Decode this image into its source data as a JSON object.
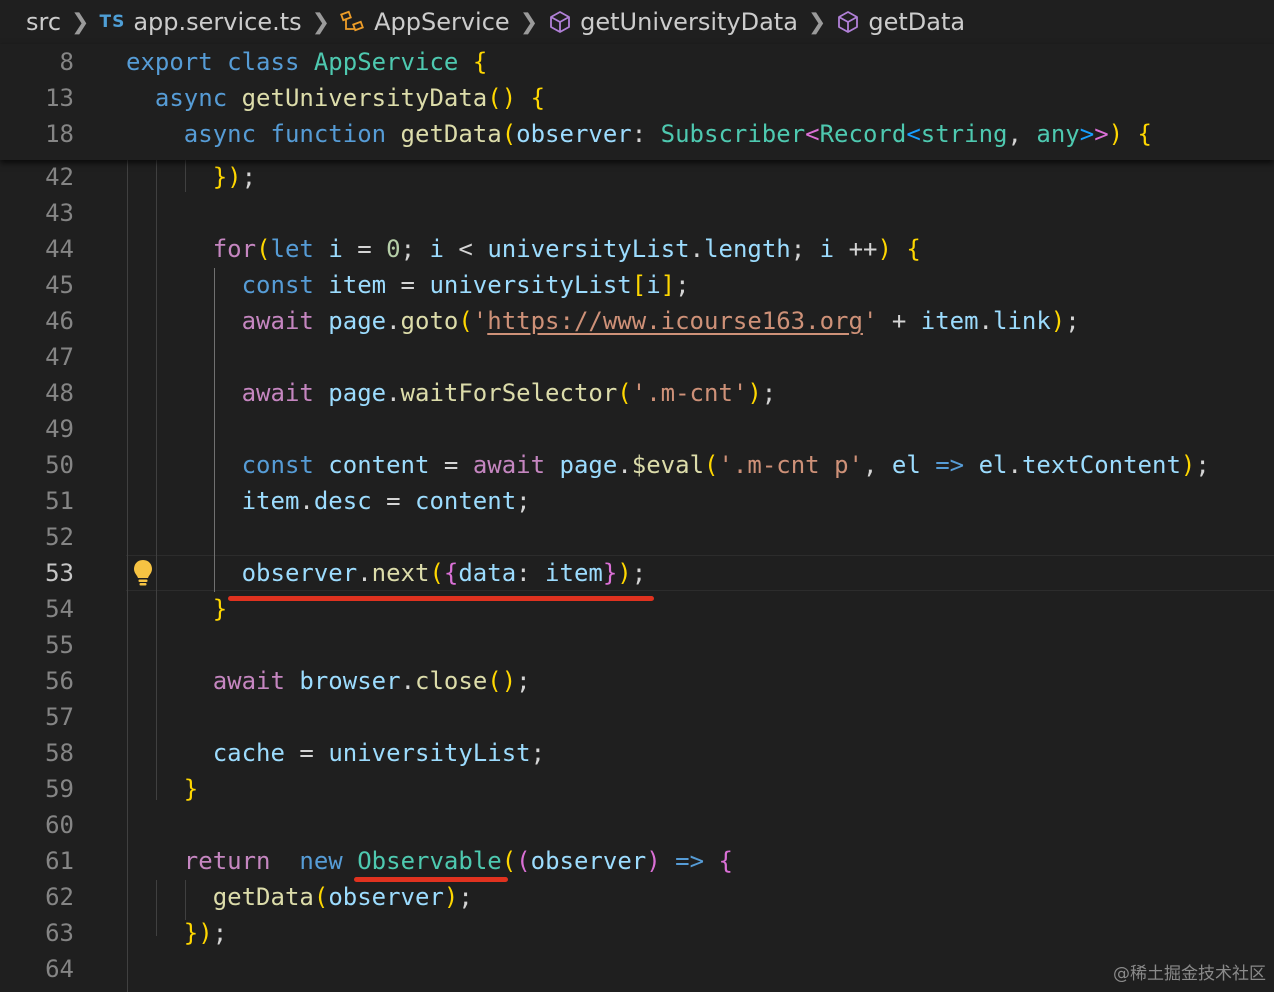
{
  "breadcrumb": {
    "folder": "src",
    "file_icon": "TS",
    "file": "app.service.ts",
    "class": "AppService",
    "method": "getUniversityData",
    "function": "getData"
  },
  "icons": {
    "typescript_file": "ts-file-icon",
    "class": "class-icon",
    "method": "method-cube-icon",
    "lightbulb": "lightbulb-icon"
  },
  "sticky_lines": [
    {
      "num": "8",
      "text": "export class AppService {"
    },
    {
      "num": "13",
      "text": "  async getUniversityData() {"
    },
    {
      "num": "18",
      "text": "    async function getData(observer: Subscriber<Record<string, any>>) {"
    }
  ],
  "lines": [
    {
      "num": "42",
      "text": "      });"
    },
    {
      "num": "43",
      "text": ""
    },
    {
      "num": "44",
      "text": "      for(let i = 0; i < universityList.length; i ++) {"
    },
    {
      "num": "45",
      "text": "        const item = universityList[i];"
    },
    {
      "num": "46",
      "text": "        await page.goto('https://www.icourse163.org' + item.link);"
    },
    {
      "num": "47",
      "text": ""
    },
    {
      "num": "48",
      "text": "        await page.waitForSelector('.m-cnt');"
    },
    {
      "num": "49",
      "text": ""
    },
    {
      "num": "50",
      "text": "        const content = await page.$eval('.m-cnt p', el => el.textContent);"
    },
    {
      "num": "51",
      "text": "        item.desc = content;"
    },
    {
      "num": "52",
      "text": ""
    },
    {
      "num": "53",
      "text": "        observer.next({data: item});"
    },
    {
      "num": "54",
      "text": "      }"
    },
    {
      "num": "55",
      "text": ""
    },
    {
      "num": "56",
      "text": "      await browser.close();"
    },
    {
      "num": "57",
      "text": ""
    },
    {
      "num": "58",
      "text": "      cache = universityList;"
    },
    {
      "num": "59",
      "text": "    }"
    },
    {
      "num": "60",
      "text": ""
    },
    {
      "num": "61",
      "text": "    return  new Observable((observer) => {"
    },
    {
      "num": "62",
      "text": "      getData(observer);"
    },
    {
      "num": "63",
      "text": "    });"
    },
    {
      "num": "64",
      "text": ""
    }
  ],
  "active_line": "53",
  "watermark": "@稀土掘金技术社区",
  "colors": {
    "background": "#1f1f1f",
    "annotation_underline": "#e0321f",
    "keyword": "#569cd6",
    "control": "#c586c0",
    "type": "#4ec9b0",
    "function": "#dcdcaa",
    "variable": "#9cdcfe",
    "string": "#ce9178",
    "number": "#b5cea8"
  }
}
